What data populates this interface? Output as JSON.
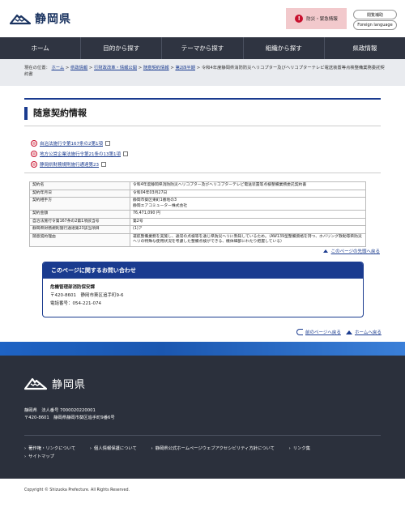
{
  "header": {
    "site_name": "静岡県",
    "emergency_label": "防災・緊急情報",
    "contrast_button": "閲覧補助",
    "language_button": "Foreign language"
  },
  "nav": {
    "items": [
      "ホーム",
      "目的から探す",
      "テーマから探す",
      "組織から探す",
      "県政情報"
    ]
  },
  "breadcrumb": {
    "prefix": "現在の位置：",
    "items": [
      "ホーム",
      "県政情報",
      "行財政改革・情報公開",
      "随意契約情報",
      "第2四半期"
    ],
    "current": "令和4年度静岡県消防防災ヘリコプター及びヘリコプターテレビ電送装置等点検整備業務委託契約書"
  },
  "page": {
    "title": "随意契約情報"
  },
  "links": [
    "自治法施行令第167条の2第1項",
    "地方公営企業法施行令第21条の13第1項",
    "静岡県財務規則施行通達第23"
  ],
  "table": {
    "rows": [
      {
        "key": "契約名",
        "value": "令和4年度静岡県消防防災ヘリコプター及びヘリコプターテレビ電送装置等点検整備業務委託契約書"
      },
      {
        "key": "契約年月日",
        "value": "令和04年03月27日"
      },
      {
        "key": "契約相手方",
        "value": "静岡市葵区東町1番地の3\n静岡エアコミューター株式会社"
      },
      {
        "key": "契約金額",
        "value": "76,471,090 円"
      },
      {
        "key": "自治法施行令第167条の2第1項該当号",
        "value": "第2号"
      },
      {
        "key": "静岡県財務規則施行通達第23該当項目",
        "value": "(1)ア"
      },
      {
        "key": "随意契約理由",
        "value": "運航整備業務を実施し、通常の点検等を通じ県防災ヘリに熟知しているため。（AW139型整備資格を持つ、ホバリング救助等県防災ヘリの特殊な使用状況を考慮した整備点検ができる、機体細部にわたり把握している）"
      }
    ]
  },
  "top_link": "このページの先頭へ戻る",
  "contact": {
    "heading": "このページに関するお問い合わせ",
    "dept": "危機管理部消防保安課",
    "address": "〒420-8601　静岡市葵区追手町9-6",
    "phone": "電話番号：054-221-074"
  },
  "bottom_nav": {
    "back": "前のページへ戻る",
    "home": "ホームへ戻る"
  },
  "footer": {
    "site_name": "静岡県",
    "corp_line": "静岡県　法人番号 7000020220001",
    "address_line": "〒420-8601　静岡県静岡市葵区追手町9番6号",
    "links": [
      "著作権・リンクについて",
      "個人情報保護について",
      "静岡県公式ホームページウェブアクセシビリティ方針について",
      "リンク集",
      "サイトマップ"
    ]
  },
  "copyright": "Copyright © Shizuoka Prefecture. All Rights Reserved.",
  "colors": {
    "brand": "#1a3b8f",
    "nav_bg": "#2f3441",
    "footer_bg": "#2b303c",
    "emergency_bg": "#f2c9cc"
  }
}
